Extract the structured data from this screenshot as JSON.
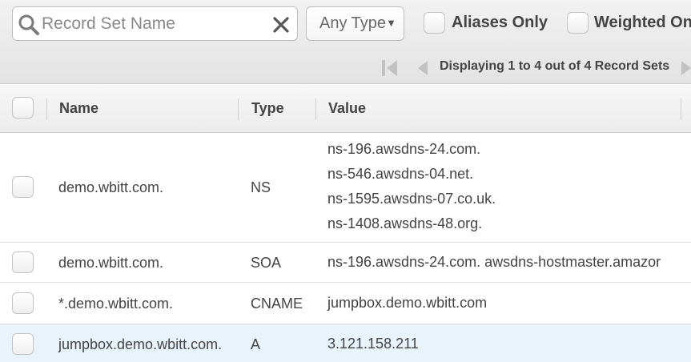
{
  "filters": {
    "search_placeholder": "Record Set Name",
    "search_value": "",
    "type_select": "Any Type",
    "aliases_only": "Aliases Only",
    "weighted_only": "Weighted On"
  },
  "pager": {
    "text": "Displaying 1 to 4 out of 4 Record Sets"
  },
  "table": {
    "columns": {
      "name": "Name",
      "type": "Type",
      "value": "Value"
    },
    "rows": [
      {
        "name": "demo.wbitt.com.",
        "type": "NS",
        "values": [
          "ns-196.awsdns-24.com.",
          "ns-546.awsdns-04.net.",
          "ns-1595.awsdns-07.co.uk.",
          "ns-1408.awsdns-48.org."
        ]
      },
      {
        "name": "demo.wbitt.com.",
        "type": "SOA",
        "values": [
          "ns-196.awsdns-24.com. awsdns-hostmaster.amazor"
        ]
      },
      {
        "name": "*.demo.wbitt.com.",
        "type": "CNAME",
        "values": [
          "jumpbox.demo.wbitt.com"
        ]
      },
      {
        "name": "jumpbox.demo.wbitt.com.",
        "type": "A",
        "values": [
          "3.121.158.211"
        ]
      }
    ]
  },
  "colors": {
    "toolbar_bg": "#e8e8e8",
    "selected_row_bg": "#e9f3fb",
    "text": "#444444"
  }
}
